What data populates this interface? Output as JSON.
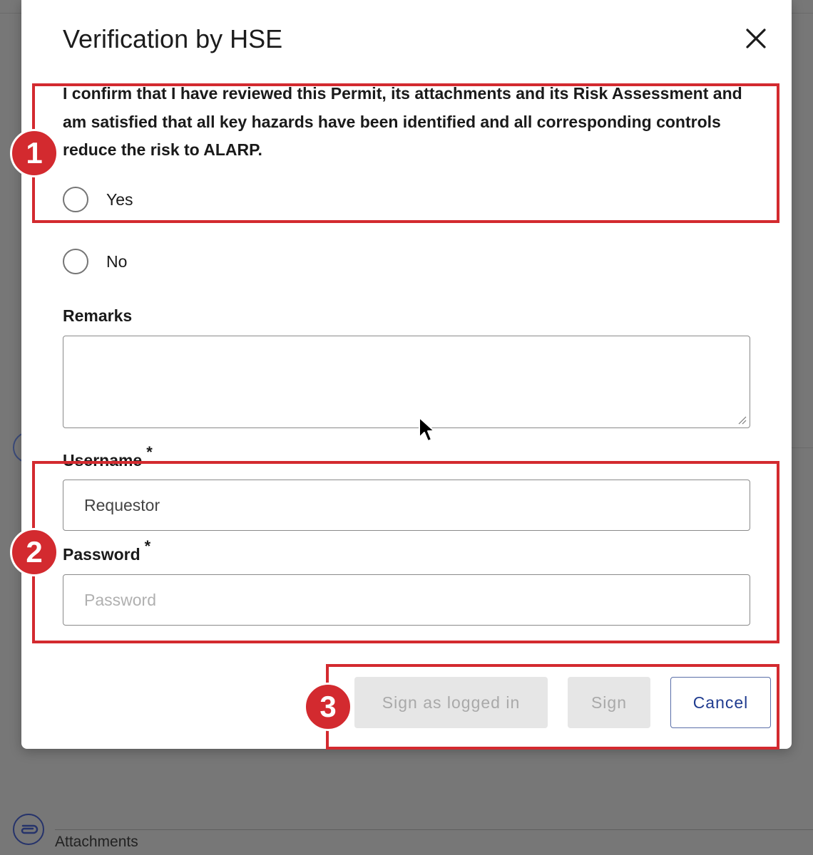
{
  "dialog": {
    "title": "Verification by HSE",
    "close_icon": "close-icon",
    "statement": "I confirm that I have reviewed this Permit, its attachments and its Risk Assessment and am satisfied that all key hazards have been identified and all corresponding controls reduce the risk to ALARP.",
    "options": {
      "yes": "Yes",
      "no": "No"
    },
    "remarks": {
      "label": "Remarks",
      "value": ""
    },
    "username": {
      "label": "Username",
      "required_mark": "*",
      "value": "Requestor"
    },
    "password": {
      "label": "Password",
      "required_mark": "*",
      "placeholder": "Password"
    },
    "buttons": {
      "sign_logged_in": "Sign as logged in",
      "sign": "Sign",
      "cancel": "Cancel"
    }
  },
  "background": {
    "attachments_label": "Attachments",
    "attachments_icon": "paperclip-icon"
  },
  "annotations": {
    "badge_1": "1",
    "badge_2": "2",
    "badge_3": "3",
    "color": "#d32a2f"
  }
}
